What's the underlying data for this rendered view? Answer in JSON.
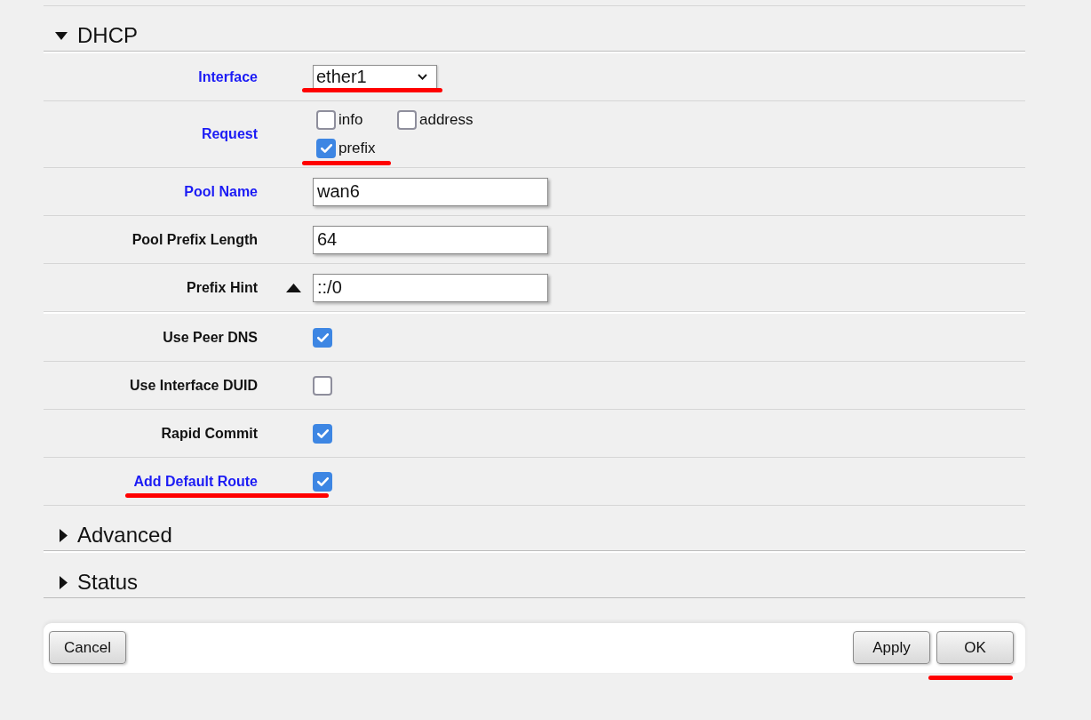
{
  "sections": [
    {
      "title": "DHCP",
      "expanded": true,
      "groups": [
        {
          "rows": [
            {
              "kind": "select",
              "label": "Interface",
              "required": true,
              "value": "ether1",
              "annotated": true
            },
            {
              "kind": "options",
              "label": "Request",
              "required": true,
              "options": [
                {
                  "label": "info",
                  "checked": false,
                  "annotated": false
                },
                {
                  "label": "address",
                  "checked": false,
                  "annotated": false
                },
                {
                  "label": "prefix",
                  "checked": true,
                  "annotated": true
                }
              ]
            },
            {
              "kind": "text",
              "label": "Pool Name",
              "required": true,
              "value": "wan6",
              "annotated": false
            },
            {
              "kind": "text",
              "label": "Pool Prefix Length",
              "required": false,
              "value": "64",
              "annotated": false
            },
            {
              "kind": "text",
              "label": "Prefix Hint",
              "required": false,
              "value": "::/0",
              "toggle": true,
              "annotated": false
            }
          ]
        },
        {
          "rows": [
            {
              "kind": "checkbox",
              "label": "Use Peer DNS",
              "required": false,
              "checked": true,
              "annotated": false
            },
            {
              "kind": "checkbox",
              "label": "Use Interface DUID",
              "required": false,
              "checked": false,
              "annotated": false
            },
            {
              "kind": "checkbox",
              "label": "Rapid Commit",
              "required": false,
              "checked": true,
              "annotated": false
            },
            {
              "kind": "checkbox",
              "label": "Add Default Route",
              "required": true,
              "checked": true,
              "annotated": true
            }
          ]
        }
      ]
    },
    {
      "title": "Advanced",
      "expanded": false
    },
    {
      "title": "Status",
      "expanded": false
    }
  ],
  "footer": {
    "left_buttons": [
      {
        "label": "Cancel",
        "annotated": false
      }
    ],
    "right_buttons": [
      {
        "label": "Apply",
        "annotated": false
      },
      {
        "label": "OK",
        "annotated": true
      }
    ]
  }
}
